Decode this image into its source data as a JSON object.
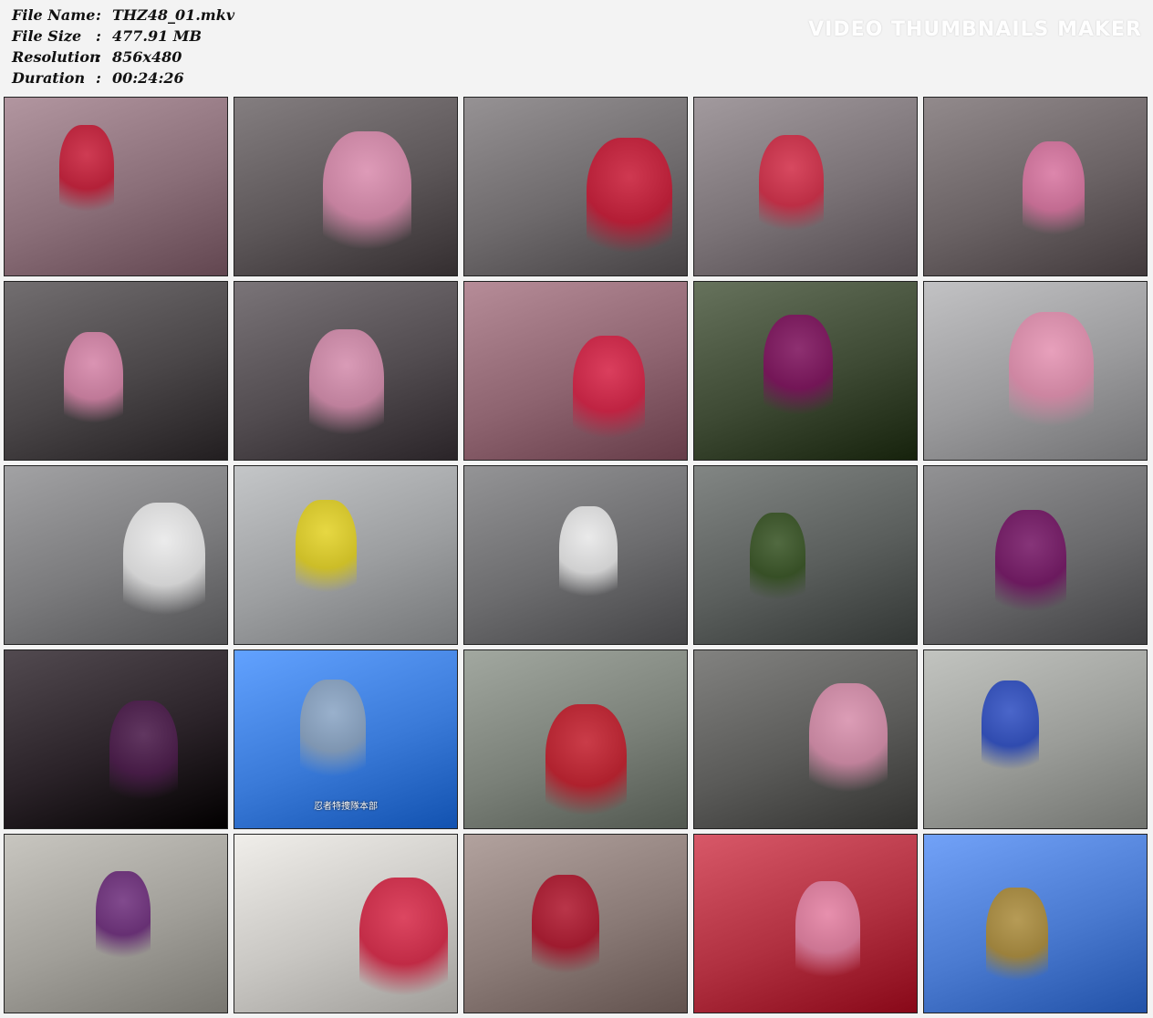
{
  "header": {
    "rows": [
      {
        "label": "File Name",
        "sep": ":",
        "value": "THZ48_01.mkv"
      },
      {
        "label": "File Size",
        "sep": ":",
        "value": "477.91 MB"
      },
      {
        "label": "Resolution",
        "sep": ":",
        "value": "856x480"
      },
      {
        "label": "Duration",
        "sep": ":",
        "value": "00:24:26"
      }
    ],
    "watermark": "VIDEO THUMBNAILS MAKER"
  },
  "grid": {
    "columns": 5,
    "rows": 5,
    "thumbnails": [
      {
        "scene": "heroine-helmet-closeup-restrained",
        "bg": "#8a6e78",
        "accent": "#d8304a"
      },
      {
        "scene": "heroine-pink-hanging-villain",
        "bg": "#5c5658",
        "accent": "#f4a6c8"
      },
      {
        "scene": "heroine-red-helmet-arms-up",
        "bg": "#6e6a6c",
        "accent": "#e0304c"
      },
      {
        "scene": "heroine-face-arms-up",
        "bg": "#7a7276",
        "accent": "#e6405a"
      },
      {
        "scene": "pink-skirt-closeup",
        "bg": "#6a6264",
        "accent": "#f08cb8"
      },
      {
        "scene": "villains-and-heroine-hanging",
        "bg": "#4a4648",
        "accent": "#f2a0c4"
      },
      {
        "scene": "soldier-and-heroine-hanging",
        "bg": "#524c50",
        "accent": "#f0a8c8"
      },
      {
        "scene": "heroine-yellow-visor-closeup",
        "bg": "#8e6470",
        "accent": "#e8385a"
      },
      {
        "scene": "purple-villain-mask-closeup",
        "bg": "#3e4a34",
        "accent": "#9a2a7a"
      },
      {
        "scene": "heroine-cape-spread-wall",
        "bg": "#9a9a9c",
        "accent": "#f4a0c0"
      },
      {
        "scene": "team-five-caped-heroes",
        "bg": "#7a7a7c",
        "accent": "#ffffff"
      },
      {
        "scene": "team-pose-yellow-star",
        "bg": "#9c9ea0",
        "accent": "#f2e030"
      },
      {
        "scene": "heroine-vs-soldier-wall",
        "bg": "#6c6c6e",
        "accent": "#ffffff"
      },
      {
        "scene": "soldiers-running-wall",
        "bg": "#5a5e5c",
        "accent": "#4e6a3a"
      },
      {
        "scene": "villain-and-soldier-wall",
        "bg": "#6a6a6c",
        "accent": "#8a2a7a"
      },
      {
        "scene": "dark-villain-closeup",
        "bg": "#2a2228",
        "accent": "#6a3a6a"
      },
      {
        "scene": "skyscraper-blue-sky",
        "bg": "#3a7ad8",
        "accent": "#a8b8c8",
        "subtitle": "忍者特捜隊本部"
      },
      {
        "scene": "man-and-woman-indoors",
        "bg": "#7a8078",
        "accent": "#d83040"
      },
      {
        "scene": "heroine-vs-soldier-gate",
        "bg": "#5a5a58",
        "accent": "#f2a8c6"
      },
      {
        "scene": "blue-helmet-hero-underpass",
        "bg": "#9a9c98",
        "accent": "#3a5ad0"
      },
      {
        "scene": "group-at-fence",
        "bg": "#a09e98",
        "accent": "#7a3a8a"
      },
      {
        "scene": "heroine-helmet-white-cape",
        "bg": "#c8c6c2",
        "accent": "#e03050"
      },
      {
        "scene": "blurry-motion-red",
        "bg": "#8a7a76",
        "accent": "#c02840"
      },
      {
        "scene": "heroine-fallen-red-cape",
        "bg": "#b03040",
        "accent": "#f0a0c0"
      },
      {
        "scene": "buildings-trees-sky",
        "bg": "#4a7ad0",
        "accent": "#c8a040"
      }
    ]
  }
}
